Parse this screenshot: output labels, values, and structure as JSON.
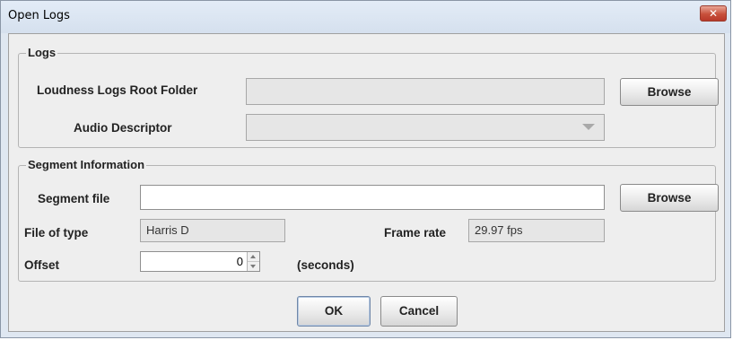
{
  "window": {
    "title": "Open Logs",
    "close_glyph": "✕",
    "close_icon": "close-icon"
  },
  "logs": {
    "legend": "Logs",
    "root_folder_label": "Loudness Logs Root Folder",
    "root_folder_value": "",
    "browse_label": "Browse",
    "audio_descriptor_label": "Audio Descriptor",
    "audio_descriptor_value": "",
    "dropdown_icon": "chevron-down-icon"
  },
  "segment": {
    "legend": "Segment Information",
    "segment_file_label": "Segment file",
    "segment_file_value": "",
    "browse_label": "Browse",
    "file_type_label": "File of type",
    "file_type_value": "Harris D",
    "frame_rate_label": "Frame rate",
    "frame_rate_value": "29.97 fps",
    "offset_label": "Offset",
    "offset_value": "0",
    "offset_unit": "(seconds)"
  },
  "footer": {
    "ok_label": "OK",
    "cancel_label": "Cancel"
  },
  "colors": {
    "title_bg": "#dbe5f1",
    "panel_bg": "#eeeeee",
    "close_red": "#c8503b"
  }
}
